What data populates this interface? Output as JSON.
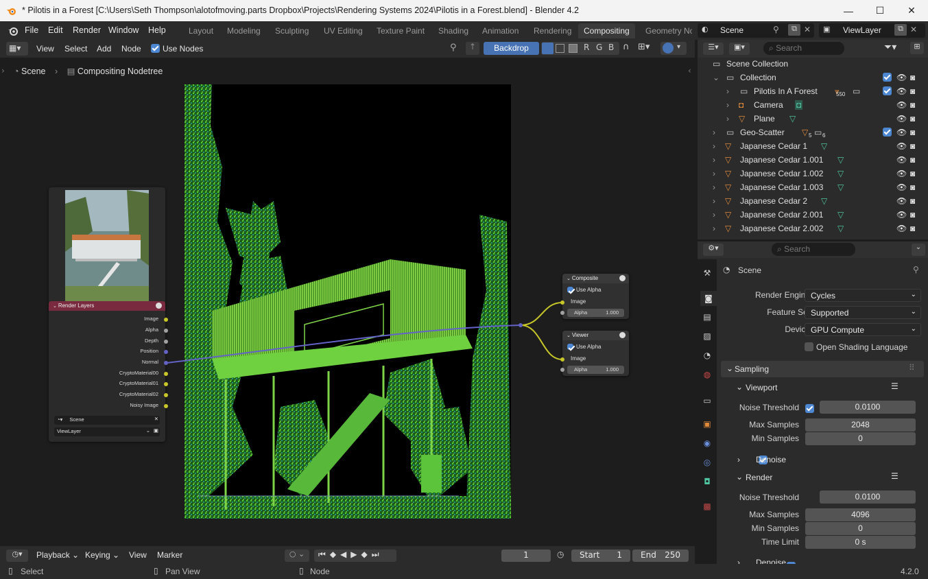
{
  "window": {
    "title": "* Pilotis in a Forest [C:\\Users\\Seth Thompson\\alotofmoving.parts Dropbox\\Projects\\Rendering Systems 2024\\Pilotis in a Forest.blend] - Blender 4.2",
    "minimize": "—",
    "maximize": "☐",
    "close": "✕"
  },
  "menu": [
    "File",
    "Edit",
    "Render",
    "Window",
    "Help"
  ],
  "workspaces": [
    "Layout",
    "Modeling",
    "Sculpting",
    "UV Editing",
    "Texture Paint",
    "Shading",
    "Animation",
    "Rendering",
    "Compositing",
    "Geometry No"
  ],
  "active_workspace": "Compositing",
  "scene_selector": "Scene",
  "viewlayer_selector": "ViewLayer",
  "node_header": {
    "items": [
      "View",
      "Select",
      "Add",
      "Node"
    ],
    "use_nodes": "Use Nodes",
    "backdrop": "Backdrop",
    "channels": [
      "R",
      "G",
      "B"
    ]
  },
  "breadcrumb": {
    "scene": "Scene",
    "tree": "Compositing Nodetree"
  },
  "nodes": {
    "render_layers": {
      "title": "Render Layers",
      "outputs": [
        "Image",
        "Alpha",
        "Depth",
        "Position",
        "Normal",
        "CryptoMaterial00",
        "CryptoMaterial01",
        "CryptoMaterial02",
        "Noisy Image"
      ],
      "scene": "Scene",
      "view_layer": "ViewLayer"
    },
    "composite": {
      "title": "Composite",
      "use_alpha": "Use Alpha",
      "image": "Image",
      "alpha": "Alpha",
      "alpha_value": "1.000"
    },
    "viewer": {
      "title": "Viewer",
      "use_alpha": "Use Alpha",
      "image": "Image",
      "alpha": "Alpha",
      "alpha_value": "1.000"
    }
  },
  "outliner": {
    "search_placeholder": "Search",
    "rows": [
      {
        "label": "Scene Collection"
      },
      {
        "label": "Collection"
      },
      {
        "label": "Pilotis In A Forest",
        "badge": "550"
      },
      {
        "label": "Camera"
      },
      {
        "label": "Plane"
      },
      {
        "label": "Geo-Scatter",
        "badge1": "5",
        "badge2": "6"
      },
      {
        "label": "Japanese Cedar 1"
      },
      {
        "label": "Japanese Cedar 1.001"
      },
      {
        "label": "Japanese Cedar 1.002"
      },
      {
        "label": "Japanese Cedar 1.003"
      },
      {
        "label": "Japanese Cedar 2"
      },
      {
        "label": "Japanese Cedar 2.001"
      },
      {
        "label": "Japanese Cedar 2.002"
      }
    ]
  },
  "properties": {
    "search_placeholder": "Search",
    "context": "Scene",
    "render_engine_label": "Render Engine",
    "render_engine": "Cycles",
    "feature_set_label": "Feature Set",
    "feature_set": "Supported",
    "device_label": "Device",
    "device": "GPU Compute",
    "osl": "Open Shading Language",
    "sampling": "Sampling",
    "viewport": "Viewport",
    "noise_threshold_label": "Noise Threshold",
    "vp_noise": "0.0100",
    "max_samples_label": "Max Samples",
    "vp_max": "2048",
    "min_samples_label": "Min Samples",
    "vp_min": "0",
    "denoise": "Denoise",
    "render": "Render",
    "r_noise": "0.0100",
    "r_max": "4096",
    "r_min": "0",
    "time_limit_label": "Time Limit",
    "time_limit": "0 s",
    "denoise2": "Denoise"
  },
  "timeline": {
    "playback": "Playback",
    "keying": "Keying",
    "view": "View",
    "marker": "Marker",
    "current_frame": "1",
    "start_label": "Start",
    "start": "1",
    "end_label": "End",
    "end": "250"
  },
  "status": {
    "select": "Select",
    "pan": "Pan View",
    "node": "Node",
    "version": "4.2.0"
  }
}
